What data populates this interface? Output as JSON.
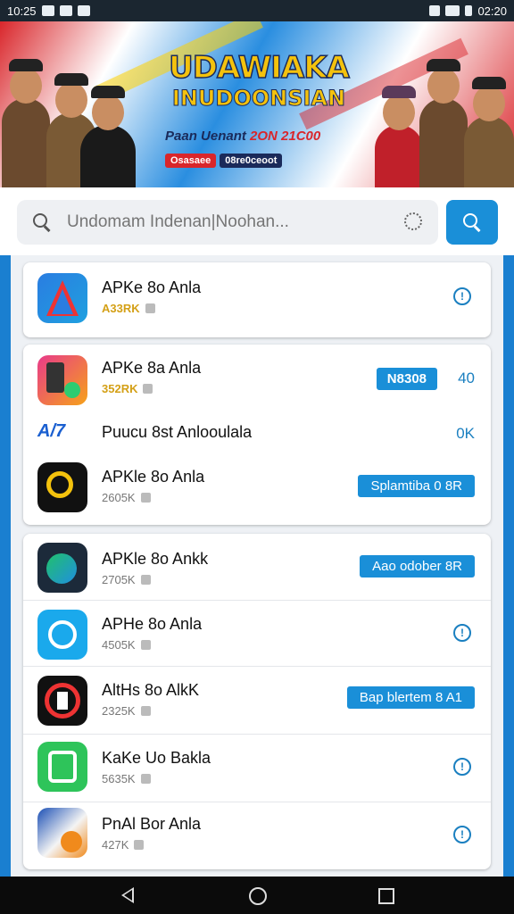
{
  "status_bar": {
    "time": "10:25",
    "right_time": "02:20"
  },
  "banner": {
    "title": "UDAWIAKA",
    "subtitle": "INUDOONSIAN",
    "line3_a": "Paan Uenant",
    "line3_b": "2ON 21C00",
    "tag1": "Osasaee",
    "tag2": "08re0ceoot"
  },
  "search": {
    "placeholder": "Undomam Indenan|Noohan..."
  },
  "apps": [
    {
      "name": "APKe 8o Anla",
      "meta": "A33RK"
    },
    {
      "name": "APKe 8a Anla",
      "meta": "352RK",
      "badge": "N8308",
      "side": "40"
    },
    {
      "name": "Puucu 8st Anlooulala",
      "side": "0K"
    },
    {
      "name": "APKle 8o Anla",
      "meta": "2605K",
      "button": "Splamtiba  0  8R"
    },
    {
      "name": "APKle 8o Ankk",
      "meta": "2705K",
      "button": "Aao odober   8R"
    },
    {
      "name": "APHe 8o Anla",
      "meta": "4505K"
    },
    {
      "name": "AltHs 8o AlkK",
      "meta": "2325K",
      "button": "Bap blertem  8  A1"
    },
    {
      "name": "KaKe Uo Bakla",
      "meta": "5635K"
    },
    {
      "name": "PnAl Bor Anla",
      "meta": "427K"
    }
  ],
  "icons": {
    "status": [
      "image-icon",
      "notification-icon",
      "sim-icon",
      "signal-icon",
      "wifi-icon",
      "battery-icon"
    ],
    "nav": [
      "back-icon",
      "home-icon",
      "recents-icon"
    ]
  },
  "colors": {
    "accent": "#1a8fd8",
    "gold": "#d4a017"
  }
}
